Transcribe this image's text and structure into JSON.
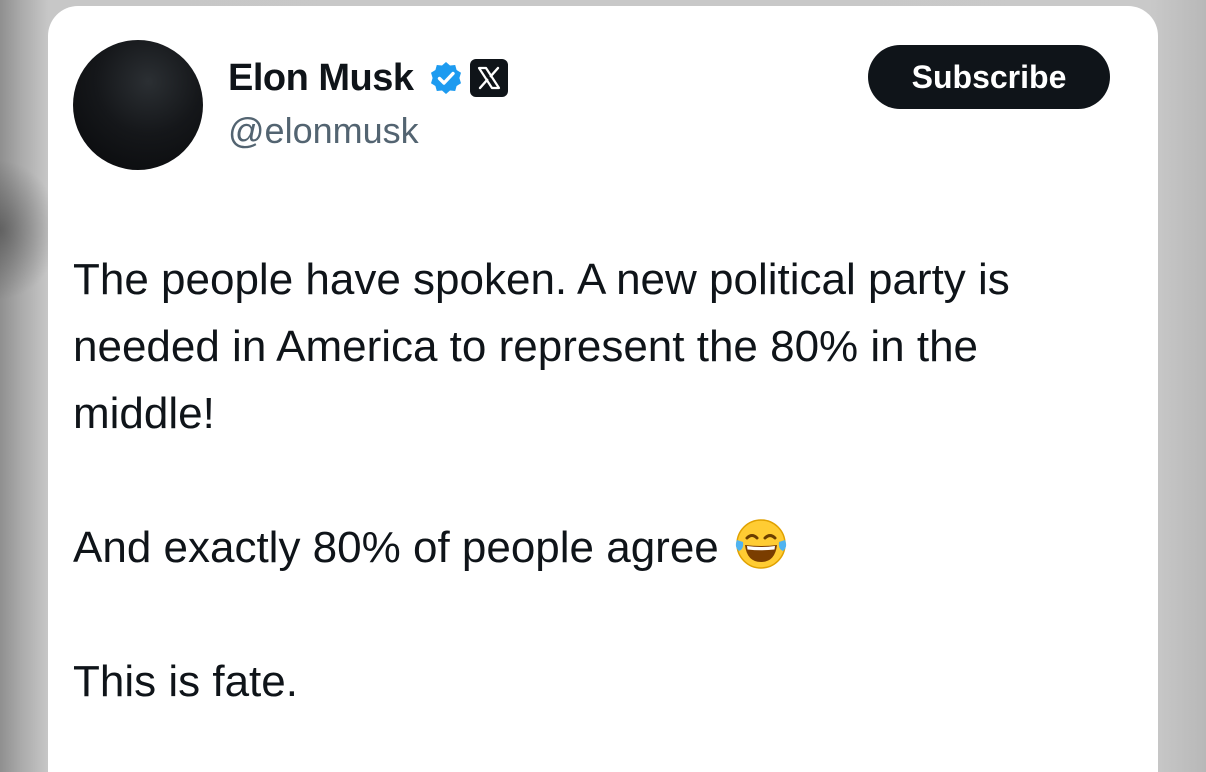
{
  "author": {
    "display_name": "Elon Musk",
    "handle": "@elonmusk",
    "verified_icon": "verified-badge-icon",
    "affiliation_icon": "x-logo-icon"
  },
  "actions": {
    "subscribe_label": "Subscribe"
  },
  "tweet": {
    "paragraph_1": "The people have spoken. A new political party is needed in America to represent the 80% in the middle!",
    "paragraph_2": "And exactly 80% of people agree",
    "paragraph_2_emoji": "face-with-tears-of-joy-icon",
    "paragraph_3": "This is fate."
  },
  "colors": {
    "text_primary": "#0f1419",
    "text_secondary": "#536471",
    "verified_blue": "#1d9bf0",
    "button_bg": "#0f1419"
  }
}
